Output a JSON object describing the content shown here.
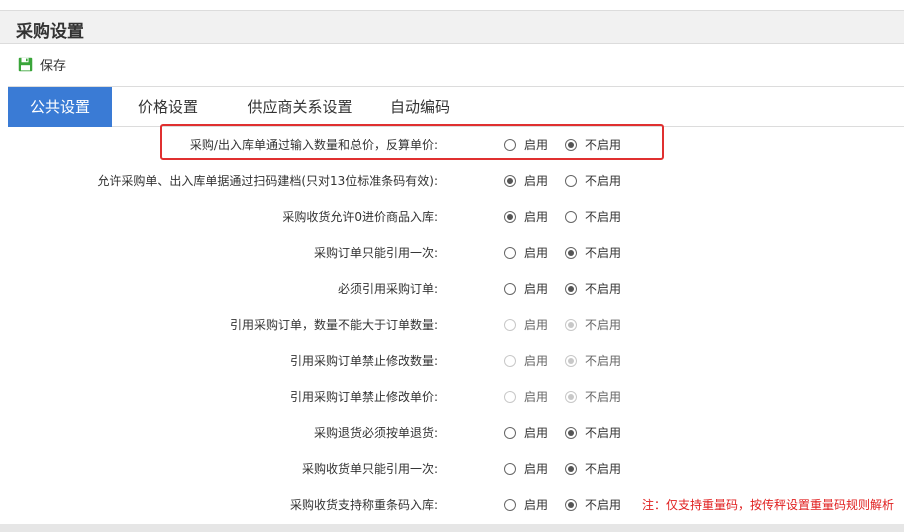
{
  "header": {
    "title": "采购设置"
  },
  "toolbar": {
    "save_label": "保存",
    "save_icon": "save-icon",
    "save_icon_color": "#3aa53a"
  },
  "tabs": [
    {
      "label": "公共设置",
      "active": true
    },
    {
      "label": "价格设置",
      "active": false
    },
    {
      "label": "供应商关系设置",
      "active": false
    },
    {
      "label": "自动编码",
      "active": false
    }
  ],
  "accent_color": "#3a7bd5",
  "highlight_color": "#e03030",
  "settings": [
    {
      "label": "采购/出入库单通过输入数量和总价，反算单价:",
      "enable_label": "启用",
      "disable_label": "不启用",
      "value": "不启用",
      "disabled": false,
      "highlighted": true
    },
    {
      "label": "允许采购单、出入库单据通过扫码建档(只对13位标准条码有效):",
      "enable_label": "启用",
      "disable_label": "不启用",
      "value": "启用",
      "disabled": false
    },
    {
      "label": "采购收货允许0进价商品入库:",
      "enable_label": "启用",
      "disable_label": "不启用",
      "value": "启用",
      "disabled": false
    },
    {
      "label": "采购订单只能引用一次:",
      "enable_label": "启用",
      "disable_label": "不启用",
      "value": "不启用",
      "disabled": false
    },
    {
      "label": "必须引用采购订单:",
      "enable_label": "启用",
      "disable_label": "不启用",
      "value": "不启用",
      "disabled": false
    },
    {
      "label": "引用采购订单，数量不能大于订单数量:",
      "enable_label": "启用",
      "disable_label": "不启用",
      "value": "不启用",
      "disabled": true
    },
    {
      "label": "引用采购订单禁止修改数量:",
      "enable_label": "启用",
      "disable_label": "不启用",
      "value": "不启用",
      "disabled": true
    },
    {
      "label": "引用采购订单禁止修改单价:",
      "enable_label": "启用",
      "disable_label": "不启用",
      "value": "不启用",
      "disabled": true
    },
    {
      "label": "采购退货必须按单退货:",
      "enable_label": "启用",
      "disable_label": "不启用",
      "value": "不启用",
      "disabled": false
    },
    {
      "label": "采购收货单只能引用一次:",
      "enable_label": "启用",
      "disable_label": "不启用",
      "value": "不启用",
      "disabled": false
    },
    {
      "label": "采购收货支持称重条码入库:",
      "enable_label": "启用",
      "disable_label": "不启用",
      "value": "不启用",
      "disabled": false,
      "note": "注：仅支持重量码，按传秤设置重量码规则解析"
    }
  ]
}
